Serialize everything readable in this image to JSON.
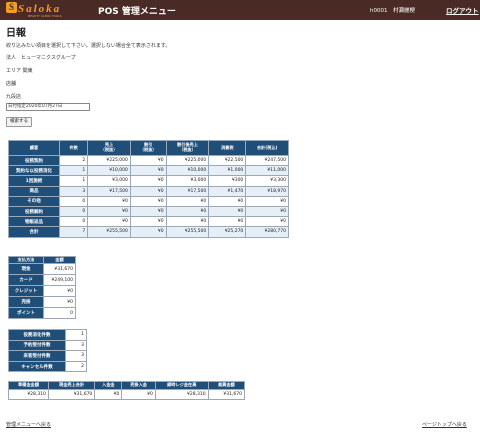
{
  "header": {
    "logo_text": "Saloka",
    "logo_sub": "BEAUTY CLINIC TOOLS",
    "title": "POS 管理メニュー",
    "user": "h0001　村瀬麗梗",
    "logout": "ログアウト"
  },
  "page_title": "日報",
  "instruction": "絞り込みたい項目を選択して下さい。選択しない場合全て表示されます。",
  "filters": {
    "corp": "法人　ヒューマニクスグループ",
    "area": "エリア 関東",
    "store": "店舗",
    "store_value": "九段店",
    "date_label": "日付指定",
    "date_value": "2020年07月27日",
    "search_button": "検索する"
  },
  "main_table": {
    "headers": [
      "顧客",
      "件数",
      "売上\n（税抜）",
      "割引\n（税抜）",
      "割引後売上\n（税抜）",
      "消費税",
      "合計(税込)"
    ],
    "rows": [
      {
        "label": "役務契約",
        "cells": [
          "2",
          "¥225,000",
          "¥0",
          "¥225,000",
          "¥22,500",
          "¥247,500"
        ]
      },
      {
        "label": "契約な以役務消化",
        "cells": [
          "1",
          "¥10,000",
          "¥0",
          "¥10,000",
          "¥1,000",
          "¥11,000"
        ]
      },
      {
        "label": "1回施術",
        "cells": [
          "1",
          "¥3,000",
          "¥0",
          "¥3,000",
          "¥300",
          "¥3,300"
        ]
      },
      {
        "label": "商品",
        "cells": [
          "3",
          "¥17,500",
          "¥0",
          "¥17,500",
          "¥1,470",
          "¥18,970"
        ]
      },
      {
        "label": "その他",
        "cells": [
          "0",
          "¥0",
          "¥0",
          "¥0",
          "¥0",
          "¥0"
        ]
      },
      {
        "label": "役務解約",
        "cells": [
          "0",
          "¥0",
          "¥0",
          "¥0",
          "¥0",
          "¥0"
        ]
      },
      {
        "label": "物販返品",
        "cells": [
          "0",
          "¥0",
          "¥0",
          "¥0",
          "¥0",
          "¥0"
        ]
      },
      {
        "label": "合計",
        "cells": [
          "7",
          "¥255,500",
          "¥0",
          "¥255,500",
          "¥25,270",
          "¥280,770"
        ]
      }
    ]
  },
  "payment_table": {
    "headers": [
      "支払方法",
      "金額"
    ],
    "rows": [
      {
        "label": "現金",
        "value": "¥31,670"
      },
      {
        "label": "カード",
        "value": "¥249,100"
      },
      {
        "label": "クレジット",
        "value": "¥0"
      },
      {
        "label": "売掛",
        "value": "¥0"
      },
      {
        "label": "ポイント",
        "value": "0"
      }
    ]
  },
  "count_table": {
    "rows": [
      {
        "label": "役務消化件数",
        "value": "1"
      },
      {
        "label": "予約受付件数",
        "value": "3"
      },
      {
        "label": "来客受付件数",
        "value": "3"
      },
      {
        "label": "キャンセル件数",
        "value": "2"
      }
    ]
  },
  "cash_table": {
    "headers": [
      "準備金金額",
      "現金売上合計",
      "入金金",
      "売掛入金",
      "締時レジ金在高",
      "差異金額"
    ],
    "values": [
      "¥28,310",
      "¥31,670",
      "¥0",
      "¥0",
      "¥28,310",
      "¥31,670"
    ]
  },
  "footer": {
    "back_link": "管理メニューへ戻る",
    "top_link": "ページトップへ戻る"
  }
}
